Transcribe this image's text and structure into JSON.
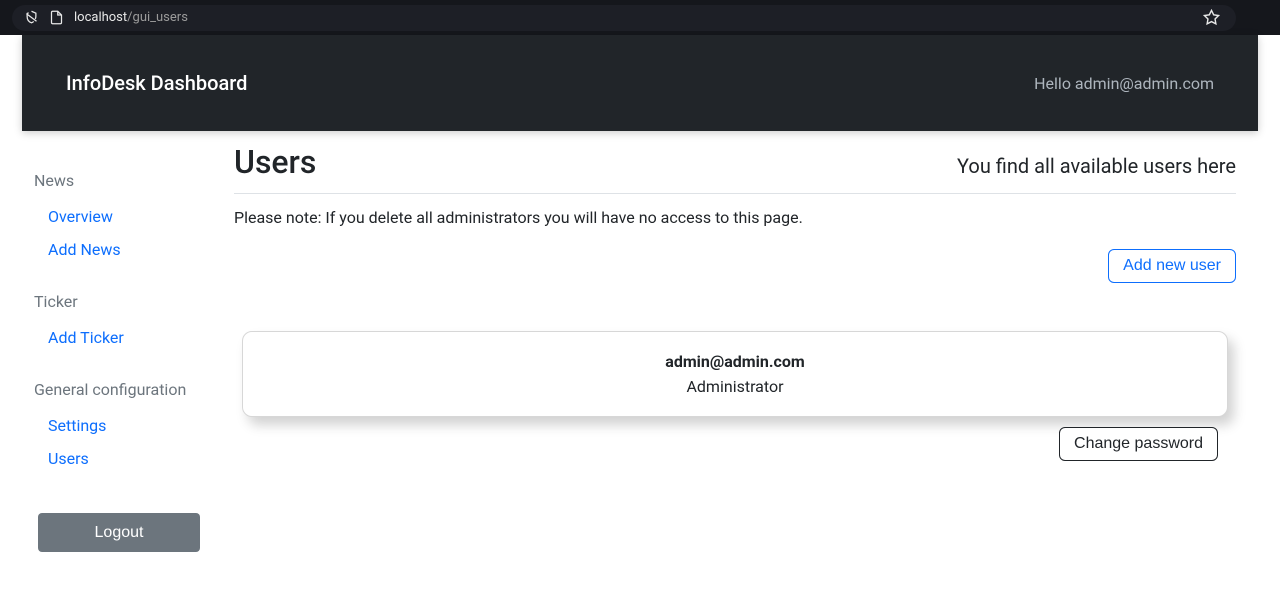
{
  "browser": {
    "host": "localhost",
    "path": "/gui_users"
  },
  "topbar": {
    "brand": "InfoDesk Dashboard",
    "greeting": "Hello admin@admin.com"
  },
  "sidebar": {
    "sections": [
      {
        "label": "News",
        "items": [
          {
            "label": "Overview",
            "name": "sidebar-link-overview"
          },
          {
            "label": "Add News",
            "name": "sidebar-link-add-news"
          }
        ]
      },
      {
        "label": "Ticker",
        "items": [
          {
            "label": "Add Ticker",
            "name": "sidebar-link-add-ticker"
          }
        ]
      },
      {
        "label": "General configuration",
        "items": [
          {
            "label": "Settings",
            "name": "sidebar-link-settings"
          },
          {
            "label": "Users",
            "name": "sidebar-link-users"
          }
        ]
      }
    ],
    "logout": "Logout"
  },
  "main": {
    "title": "Users",
    "subtitle": "You find all available users here",
    "note": "Please note: If you delete all administrators you will have no access to this page.",
    "add_button": "Add new user",
    "users": [
      {
        "email": "admin@admin.com",
        "role": "Administrator"
      }
    ],
    "change_password_button": "Change password"
  }
}
